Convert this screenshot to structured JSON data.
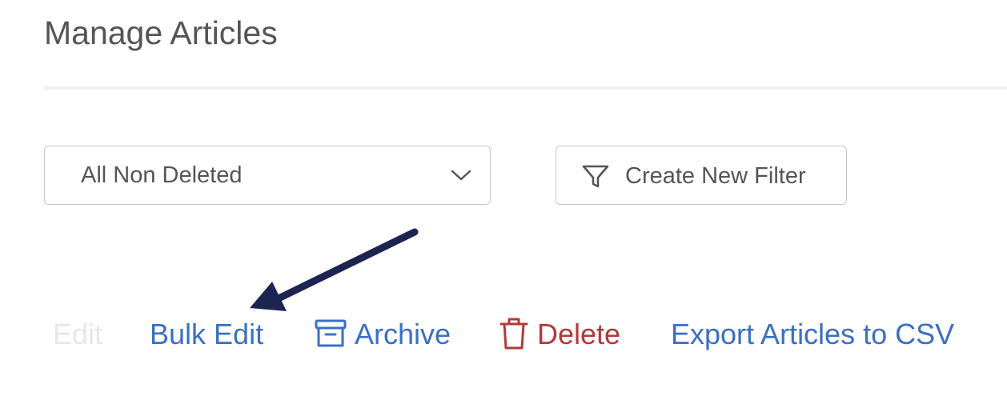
{
  "header": {
    "title": "Manage Articles"
  },
  "filters": {
    "view_select_value": "All Non Deleted",
    "create_filter_label": "Create New Filter"
  },
  "actions": {
    "edit_label": "Edit",
    "bulk_edit_label": "Bulk Edit",
    "archive_label": "Archive",
    "delete_label": "Delete",
    "export_label": "Export Articles to CSV"
  },
  "icons": {
    "select": "chevron-down-icon",
    "filter": "filter-icon",
    "archive": "archive-box-icon",
    "delete": "trash-icon",
    "annotation": "arrow-annotation"
  },
  "colors": {
    "link_blue": "#3a6fc4",
    "delete_red": "#b03a3a",
    "disabled": "#e4e7ec",
    "annotation_navy": "#1c2550"
  }
}
